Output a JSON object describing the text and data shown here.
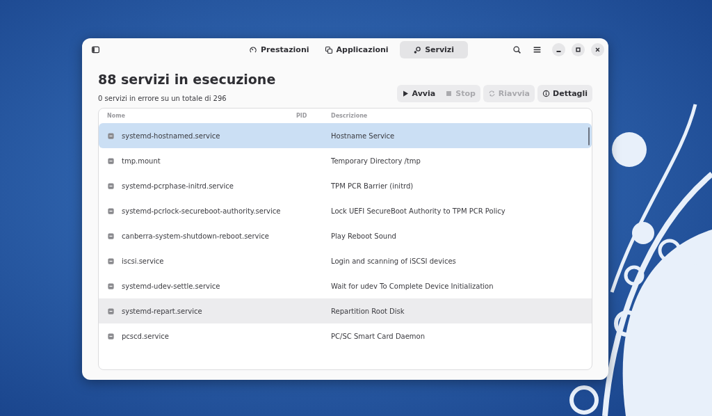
{
  "window": {
    "tabs": [
      {
        "label": "Prestazioni",
        "selected": false
      },
      {
        "label": "Applicazioni",
        "selected": false
      },
      {
        "label": "Servizi",
        "selected": true
      }
    ]
  },
  "title": "88 servizi in esecuzione",
  "subtitle": "0 servizi in errore su un totale di 296",
  "actions": [
    {
      "label": "Avvia",
      "disabled": false
    },
    {
      "label": "Stop",
      "disabled": true
    },
    {
      "label": "Riavvia",
      "disabled": true
    },
    {
      "label": "Dettagli",
      "disabled": false
    }
  ],
  "table": {
    "columns": [
      "Nome",
      "PID",
      "Descrizione"
    ],
    "rows": [
      {
        "name": "systemd-hostnamed.service",
        "description": "Hostname Service",
        "selected": true,
        "hovered": false
      },
      {
        "name": "tmp.mount",
        "description": "Temporary Directory /tmp",
        "selected": false,
        "hovered": false
      },
      {
        "name": "systemd-pcrphase-initrd.service",
        "description": "TPM PCR Barrier (initrd)",
        "selected": false,
        "hovered": false
      },
      {
        "name": "systemd-pcrlock-secureboot-authority.service",
        "description": "Lock UEFI SecureBoot Authority to TPM PCR Policy",
        "selected": false,
        "hovered": false
      },
      {
        "name": "canberra-system-shutdown-reboot.service",
        "description": "Play Reboot Sound",
        "selected": false,
        "hovered": false
      },
      {
        "name": "iscsi.service",
        "description": "Login and scanning of iSCSI devices",
        "selected": false,
        "hovered": false
      },
      {
        "name": "systemd-udev-settle.service",
        "description": "Wait for udev To Complete Device Initialization",
        "selected": false,
        "hovered": false
      },
      {
        "name": "systemd-repart.service",
        "description": "Repartition Root Disk",
        "selected": false,
        "hovered": true
      },
      {
        "name": "pcscd.service",
        "description": "PC/SC Smart Card Daemon",
        "selected": false,
        "hovered": false
      }
    ]
  }
}
